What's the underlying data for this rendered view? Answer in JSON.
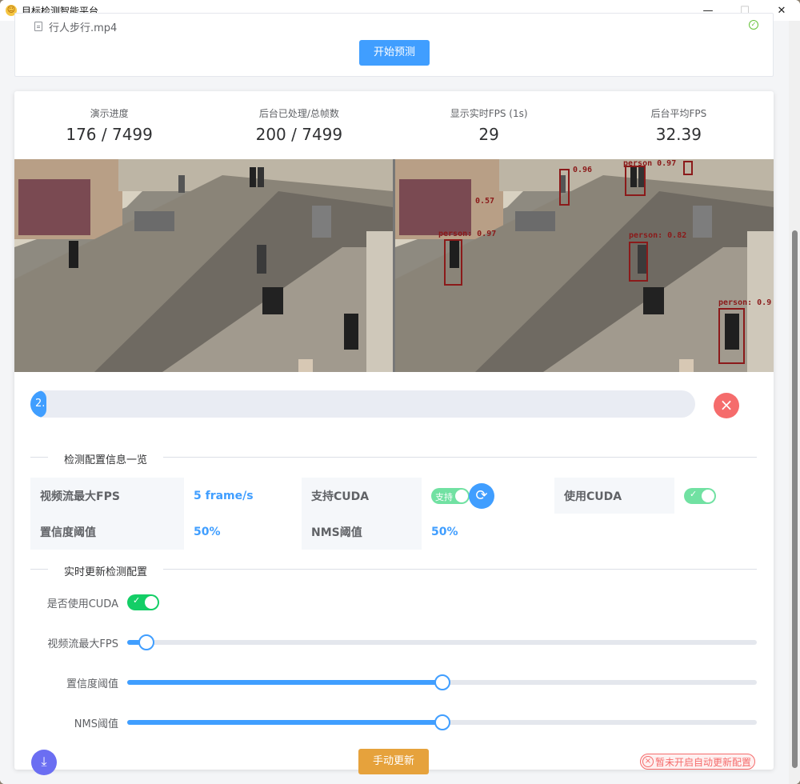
{
  "window": {
    "title": "目标检测智能平台"
  },
  "upload": {
    "filename": "行人步行.mp4",
    "start_button": "开始预测"
  },
  "stats": [
    {
      "label": "演示进度",
      "value": "176 / 7499"
    },
    {
      "label": "后台已处理/总帧数",
      "value": "200 / 7499"
    },
    {
      "label": "显示实时FPS (1s)",
      "value": "29"
    },
    {
      "label": "后台平均FPS",
      "value": "32.39"
    }
  ],
  "detections": [
    {
      "label": "0.96"
    },
    {
      "label": "person 0.97"
    },
    {
      "label": "0.57"
    },
    {
      "label": "person: 0.97"
    },
    {
      "label": "person: 0.82"
    },
    {
      "label": "person: 0.9"
    }
  ],
  "progress": {
    "text": "2.",
    "percent": 2.4
  },
  "config_info": {
    "section_title": "检测配置信息一览",
    "max_fps_label": "视频流最大FPS",
    "max_fps_value": "5 frame/s",
    "cuda_support_label": "支持CUDA",
    "cuda_support_toggle": "支持",
    "use_cuda_label": "使用CUDA",
    "conf_label": "置信度阈值",
    "conf_value": "50%",
    "nms_label": "NMS阈值",
    "nms_value": "50%"
  },
  "realtime_config": {
    "section_title": "实时更新检测配置",
    "use_cuda_label": "是否使用CUDA",
    "max_fps_label": "视频流最大FPS",
    "conf_label": "置信度阈值",
    "nms_label": "NMS阈值",
    "max_fps_level": 0.03,
    "conf_level": 0.5,
    "nms_level": 0.5,
    "manual_update_button": "手动更新",
    "auto_update_tag": "暂未开启自动更新配置"
  },
  "colors": {
    "primary": "#409eff",
    "warning": "#e6a23c",
    "danger": "#f56c6c",
    "success": "#13ce66"
  }
}
